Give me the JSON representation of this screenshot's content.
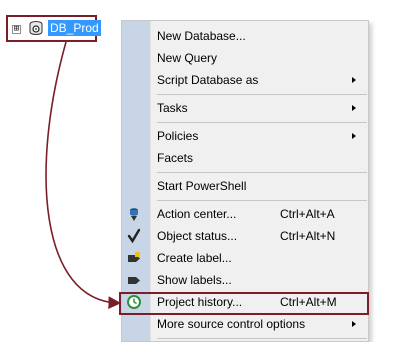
{
  "tree": {
    "node_label": "DB_Prod",
    "expander_glyph": "⊞",
    "db_icon": "database-icon"
  },
  "menu": {
    "items": [
      {
        "label": "New Database...",
        "shortcut": "",
        "submenu": false
      },
      {
        "label": "New Query",
        "shortcut": "",
        "submenu": false
      },
      {
        "label": "Script Database as",
        "shortcut": "",
        "submenu": true
      },
      {
        "label": "Tasks",
        "shortcut": "",
        "submenu": true
      },
      {
        "label": "Policies",
        "shortcut": "",
        "submenu": true
      },
      {
        "label": "Facets",
        "shortcut": "",
        "submenu": false
      },
      {
        "label": "Start PowerShell",
        "shortcut": "",
        "submenu": false
      },
      {
        "label": "Action center...",
        "shortcut": "Ctrl+Alt+A",
        "submenu": false,
        "icon": "action-center-icon"
      },
      {
        "label": "Object status...",
        "shortcut": "Ctrl+Alt+N",
        "submenu": false,
        "icon": "checkmark-icon"
      },
      {
        "label": "Create label...",
        "shortcut": "",
        "submenu": false,
        "icon": "create-label-icon"
      },
      {
        "label": "Show labels...",
        "shortcut": "",
        "submenu": false,
        "icon": "label-tag-icon"
      },
      {
        "label": "Project history...",
        "shortcut": "Ctrl+Alt+M",
        "submenu": false,
        "icon": "history-clock-icon"
      },
      {
        "label": "More source control options",
        "shortcut": "",
        "submenu": true
      }
    ]
  },
  "colors": {
    "highlight_border": "#7a1f2a",
    "selection_bg": "#3399ff",
    "menu_bg": "#f0f0f0",
    "gutter_bg": "#c8d5e6"
  }
}
